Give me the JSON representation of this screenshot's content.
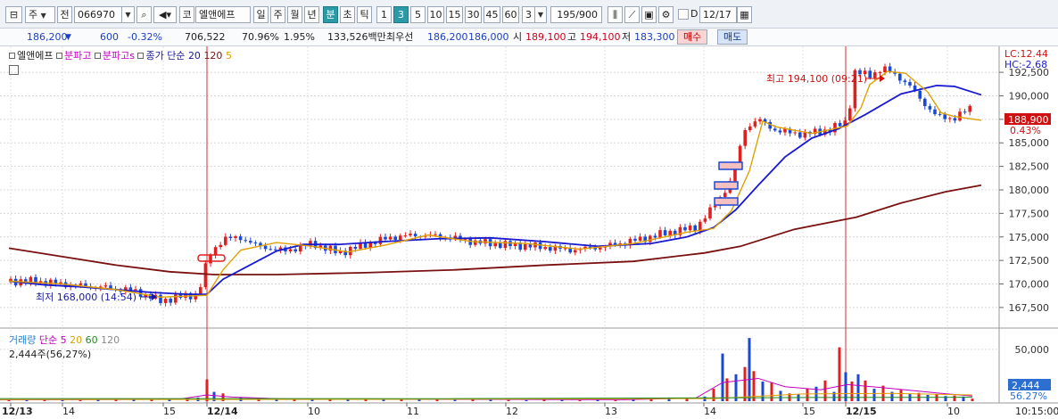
{
  "toolbar": {
    "period_type": "주",
    "prev_label": "전",
    "code": "066970",
    "market": "코",
    "stock_name": "엘앤에프",
    "period_tabs": [
      "일",
      "주",
      "월",
      "년",
      "분",
      "초",
      "틱"
    ],
    "interval_tabs": [
      "1",
      "3",
      "5",
      "10",
      "15",
      "30",
      "45",
      "60"
    ],
    "interval_value": "3",
    "count": "195/900",
    "d_label": "D",
    "date": "12/17"
  },
  "infobar": {
    "price": "186,200",
    "change": "600",
    "change_pct": "-0.32%",
    "volume": "706,522",
    "vol_ratio": "70.96%",
    "turnover": "1.95%",
    "amount": "133,526백만",
    "best_label": "최우선",
    "best_ask": "186,200",
    "best_bid": "186,000",
    "open_label": "시",
    "open": "189,100",
    "high_label": "고",
    "high": "194,100",
    "low_label": "저",
    "low": "183,300",
    "buy_label": "매수",
    "sell_label": "매도"
  },
  "legend": {
    "items": [
      "엘앤에프",
      "분파고",
      "분파고s",
      "종가 단순",
      "20",
      "120",
      "5"
    ],
    "colors": [
      "#222222",
      "#c000c0",
      "#c000c0",
      "#1a1aa0",
      "#1a1aa0",
      "#7a1010",
      "#e0a000"
    ]
  },
  "volume_legend": {
    "name": "거래량",
    "ma_label": "단순",
    "periods": [
      "5",
      "20",
      "60",
      "120"
    ],
    "period_colors": [
      "#c000c0",
      "#e0a000",
      "#228b22",
      "#888888"
    ],
    "current": "2,444주(56,27%)"
  },
  "chart_data": {
    "type": "candlestick",
    "price_axis_ticks": [
      "192,500",
      "190,000",
      "187,500",
      "185,000",
      "182,500",
      "180,000",
      "177,500",
      "175,000",
      "172,500",
      "170,000",
      "167,500"
    ],
    "price_range": [
      165500,
      194500
    ],
    "volume_axis_ticks": [
      "50,000"
    ],
    "time_labels": [
      "12/13",
      "14",
      "15",
      "12/14",
      "10",
      "11",
      "12",
      "13",
      "14",
      "15",
      "12/15",
      "10",
      "10:15:00"
    ],
    "lc_label": "LC:12.44",
    "hc_label": "HC:-2.68",
    "current_price": "188,900",
    "current_pct": "0.43%",
    "volume_current": "2,444",
    "volume_pct": "56.27%",
    "max_annotation": "최고 194,100 (09:21)",
    "min_annotation": "최저 168,000 (14:54)",
    "ma20": [
      [
        0,
        170300
      ],
      [
        40,
        169900
      ],
      [
        80,
        169700
      ],
      [
        120,
        169400
      ],
      [
        160,
        169100
      ],
      [
        200,
        168900
      ],
      [
        222,
        168900
      ],
      [
        240,
        170500
      ],
      [
        270,
        172000
      ],
      [
        300,
        173500
      ],
      [
        330,
        174200
      ],
      [
        370,
        174200
      ],
      [
        420,
        174500
      ],
      [
        480,
        174800
      ],
      [
        540,
        174900
      ],
      [
        600,
        174500
      ],
      [
        660,
        174000
      ],
      [
        720,
        174300
      ],
      [
        760,
        175000
      ],
      [
        790,
        176000
      ],
      [
        815,
        177900
      ],
      [
        840,
        180500
      ],
      [
        870,
        183500
      ],
      [
        900,
        185500
      ],
      [
        930,
        186500
      ],
      [
        960,
        188000
      ],
      [
        1000,
        190200
      ],
      [
        1040,
        191100
      ],
      [
        1060,
        191000
      ],
      [
        1090,
        190100
      ]
    ],
    "ma120": [
      [
        0,
        173800
      ],
      [
        60,
        172900
      ],
      [
        120,
        172000
      ],
      [
        180,
        171300
      ],
      [
        230,
        171000
      ],
      [
        300,
        171000
      ],
      [
        400,
        171200
      ],
      [
        500,
        171500
      ],
      [
        600,
        172000
      ],
      [
        700,
        172400
      ],
      [
        780,
        173300
      ],
      [
        820,
        174000
      ],
      [
        880,
        175800
      ],
      [
        950,
        177100
      ],
      [
        1000,
        178600
      ],
      [
        1050,
        179800
      ],
      [
        1090,
        180500
      ]
    ],
    "ma5": [
      [
        0,
        170300
      ],
      [
        60,
        170000
      ],
      [
        120,
        169400
      ],
      [
        170,
        168600
      ],
      [
        222,
        168800
      ],
      [
        240,
        171500
      ],
      [
        260,
        173600
      ],
      [
        300,
        174400
      ],
      [
        340,
        174000
      ],
      [
        380,
        173400
      ],
      [
        420,
        174100
      ],
      [
        470,
        175200
      ],
      [
        520,
        174500
      ],
      [
        580,
        174300
      ],
      [
        640,
        173700
      ],
      [
        700,
        174300
      ],
      [
        760,
        175500
      ],
      [
        790,
        175900
      ],
      [
        810,
        177800
      ],
      [
        830,
        182000
      ],
      [
        845,
        187300
      ],
      [
        860,
        186700
      ],
      [
        900,
        186000
      ],
      [
        940,
        186800
      ],
      [
        955,
        188700
      ],
      [
        965,
        191200
      ],
      [
        985,
        192600
      ],
      [
        1005,
        192400
      ],
      [
        1030,
        190400
      ],
      [
        1045,
        188200
      ],
      [
        1060,
        187800
      ],
      [
        1090,
        187400
      ]
    ],
    "close_path": [
      [
        10,
        170300
      ],
      [
        40,
        170300
      ],
      [
        80,
        169900
      ],
      [
        120,
        169600
      ],
      [
        150,
        169300
      ],
      [
        180,
        168200
      ],
      [
        200,
        168600
      ],
      [
        222,
        168900
      ],
      [
        234,
        173000
      ],
      [
        250,
        174800
      ],
      [
        270,
        174900
      ],
      [
        290,
        174000
      ],
      [
        320,
        173500
      ],
      [
        350,
        174300
      ],
      [
        380,
        173300
      ],
      [
        410,
        174200
      ],
      [
        440,
        175000
      ],
      [
        470,
        175200
      ],
      [
        500,
        175000
      ],
      [
        530,
        174500
      ],
      [
        560,
        174200
      ],
      [
        600,
        174000
      ],
      [
        640,
        173600
      ],
      [
        680,
        174000
      ],
      [
        720,
        174800
      ],
      [
        750,
        175500
      ],
      [
        780,
        176000
      ],
      [
        800,
        178200
      ],
      [
        820,
        181000
      ],
      [
        835,
        186500
      ],
      [
        850,
        187500
      ],
      [
        870,
        186300
      ],
      [
        900,
        185900
      ],
      [
        930,
        186400
      ],
      [
        950,
        187300
      ],
      [
        958,
        192500
      ],
      [
        975,
        192200
      ],
      [
        990,
        192900
      ],
      [
        1005,
        192200
      ],
      [
        1020,
        191000
      ],
      [
        1035,
        189300
      ],
      [
        1050,
        187800
      ],
      [
        1070,
        187600
      ],
      [
        1090,
        188900
      ]
    ],
    "volume": [
      [
        10,
        1200
      ],
      [
        30,
        900
      ],
      [
        50,
        1300
      ],
      [
        70,
        1000
      ],
      [
        90,
        1100
      ],
      [
        110,
        1500
      ],
      [
        130,
        1400
      ],
      [
        150,
        2000
      ],
      [
        170,
        1800
      ],
      [
        190,
        2200
      ],
      [
        210,
        2500
      ],
      [
        222,
        3500
      ],
      [
        232,
        21000
      ],
      [
        240,
        9000
      ],
      [
        250,
        7500
      ],
      [
        270,
        3500
      ],
      [
        290,
        2000
      ],
      [
        310,
        2500
      ],
      [
        330,
        1500
      ],
      [
        350,
        2200
      ],
      [
        370,
        1800
      ],
      [
        390,
        1600
      ],
      [
        410,
        2000
      ],
      [
        430,
        1500
      ],
      [
        450,
        1800
      ],
      [
        470,
        1600
      ],
      [
        490,
        1400
      ],
      [
        510,
        1200
      ],
      [
        530,
        1500
      ],
      [
        550,
        1200
      ],
      [
        570,
        1100
      ],
      [
        590,
        1000
      ],
      [
        610,
        1300
      ],
      [
        630,
        1100
      ],
      [
        650,
        1000
      ],
      [
        670,
        1200
      ],
      [
        690,
        1000
      ],
      [
        710,
        1300
      ],
      [
        730,
        2000
      ],
      [
        750,
        3500
      ],
      [
        770,
        2500
      ],
      [
        790,
        4500
      ],
      [
        800,
        12000
      ],
      [
        810,
        46000
      ],
      [
        815,
        22000
      ],
      [
        825,
        26000
      ],
      [
        835,
        33000
      ],
      [
        840,
        61000
      ],
      [
        845,
        29000
      ],
      [
        855,
        19000
      ],
      [
        865,
        18000
      ],
      [
        875,
        10000
      ],
      [
        885,
        7500
      ],
      [
        895,
        6500
      ],
      [
        905,
        12000
      ],
      [
        915,
        14000
      ],
      [
        925,
        20000
      ],
      [
        935,
        9000
      ],
      [
        941,
        52000
      ],
      [
        948,
        28000
      ],
      [
        955,
        19000
      ],
      [
        962,
        26000
      ],
      [
        970,
        20000
      ],
      [
        980,
        12000
      ],
      [
        990,
        15000
      ],
      [
        1000,
        9000
      ],
      [
        1010,
        11000
      ],
      [
        1020,
        7000
      ],
      [
        1030,
        8000
      ],
      [
        1040,
        6000
      ],
      [
        1050,
        6500
      ],
      [
        1060,
        5000
      ],
      [
        1070,
        5500
      ],
      [
        1080,
        4500
      ],
      [
        1090,
        2444
      ]
    ]
  }
}
